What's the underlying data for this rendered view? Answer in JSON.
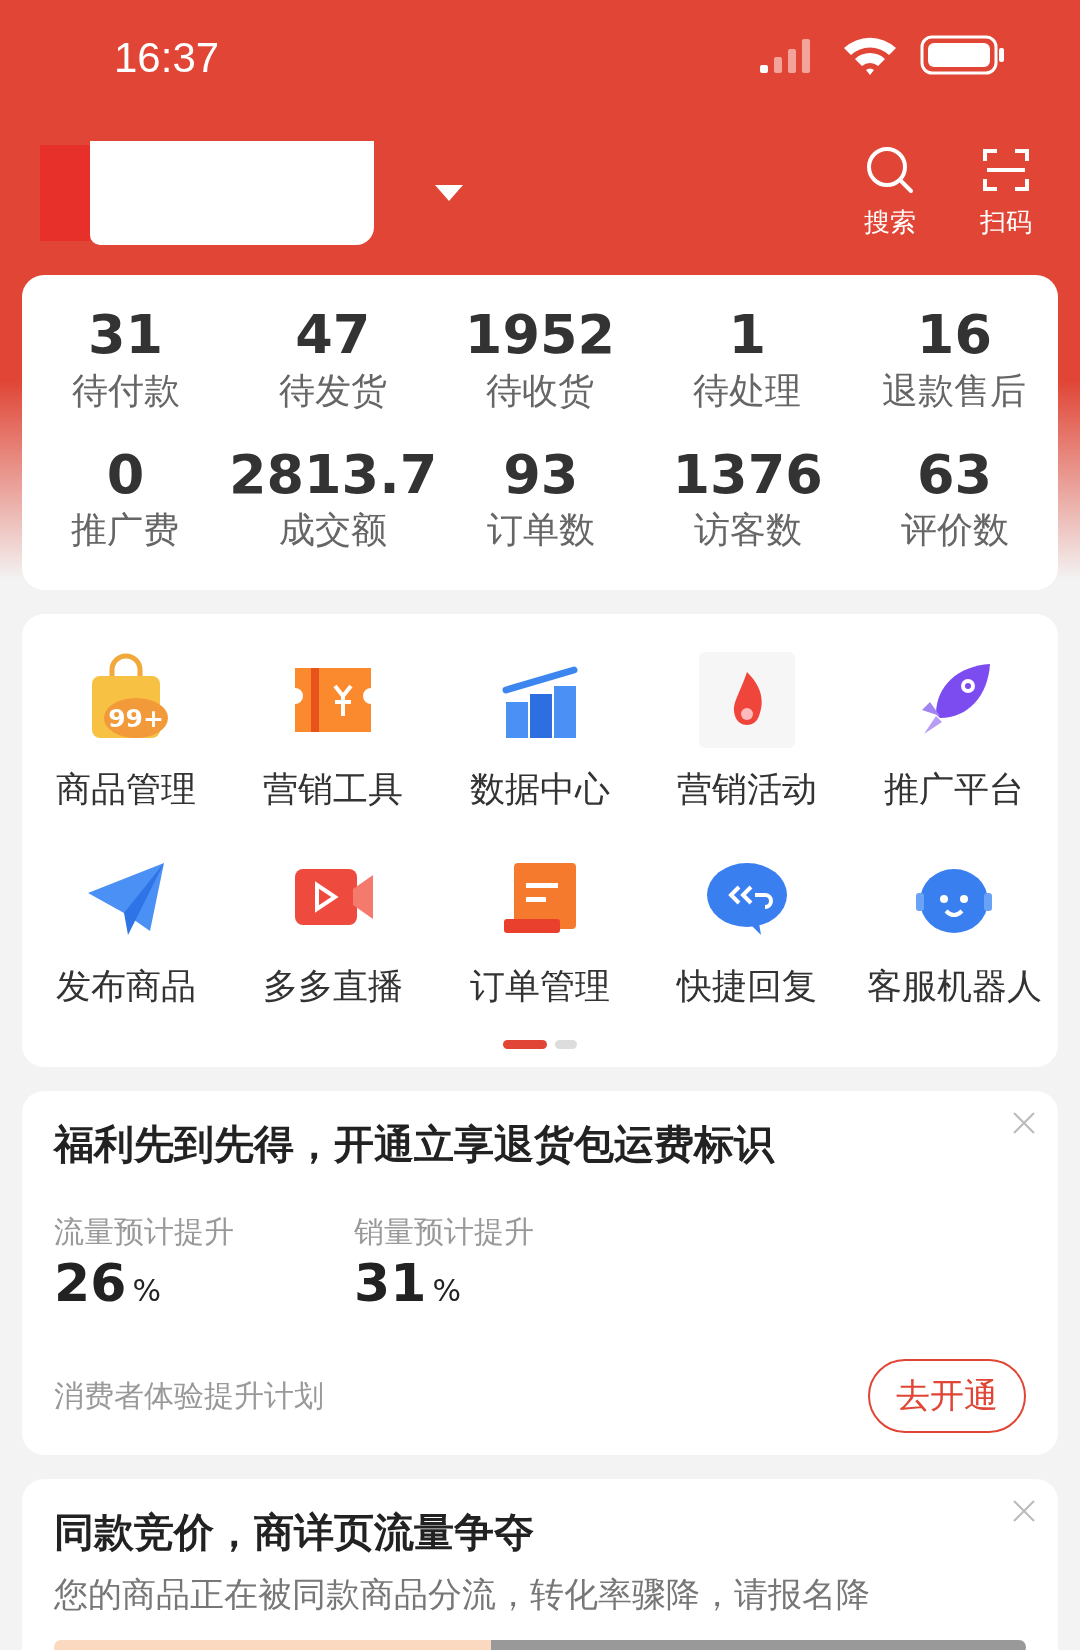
{
  "status_bar": {
    "time": "16:37"
  },
  "header": {
    "actions": [
      {
        "label": "搜索",
        "kind": "search"
      },
      {
        "label": "扫码",
        "kind": "scan"
      }
    ]
  },
  "stats": [
    [
      {
        "value": "31",
        "label": "待付款"
      },
      {
        "value": "47",
        "label": "待发货"
      },
      {
        "value": "1952",
        "label": "待收货"
      },
      {
        "value": "1",
        "label": "待处理"
      },
      {
        "value": "16",
        "label": "退款售后"
      }
    ],
    [
      {
        "value": "0",
        "label": "推广费"
      },
      {
        "value": "2813.7",
        "label": "成交额"
      },
      {
        "value": "93",
        "label": "订单数"
      },
      {
        "value": "1376",
        "label": "访客数"
      },
      {
        "value": "63",
        "label": "评价数"
      }
    ]
  ],
  "shortcuts": {
    "items": [
      {
        "label": "商品管理",
        "badge": "99+"
      },
      {
        "label": "营销工具"
      },
      {
        "label": "数据中心"
      },
      {
        "label": "营销活动"
      },
      {
        "label": "推广平台"
      },
      {
        "label": "发布商品"
      },
      {
        "label": "多多直播"
      },
      {
        "label": "订单管理"
      },
      {
        "label": "快捷回复"
      },
      {
        "label": "客服机器人"
      }
    ],
    "pages": [
      {
        "selected": true
      },
      {
        "selected": false
      }
    ]
  },
  "promo": {
    "title": "福利先到先得，开通立享退货包运费标识",
    "metrics": [
      {
        "label": "流量预计提升",
        "value": "26",
        "unit": "%"
      },
      {
        "label": "销量预计提升",
        "value": "31",
        "unit": "%"
      }
    ],
    "footer": "消费者体验提升计划",
    "button": "去开通"
  },
  "notice": {
    "title": "同款竞价，商详页流量争夺",
    "text": "您的商品正在被同款商品分流，转化率骤降，请报名降"
  }
}
